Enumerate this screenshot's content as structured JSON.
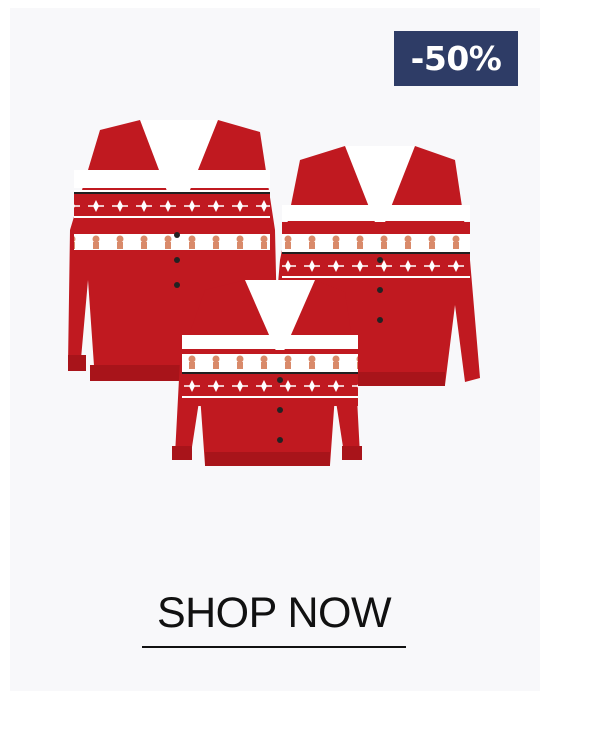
{
  "promo": {
    "discount_badge": "-50%",
    "cta_label": "SHOP NOW"
  },
  "product_image": {
    "icon": "family-matching-christmas-cardigans",
    "colors": {
      "sweater_red": "#c01920",
      "pattern_white": "#ffffff",
      "gingerbread": "#d98a6a",
      "badge_navy": "#2e3c66"
    }
  }
}
